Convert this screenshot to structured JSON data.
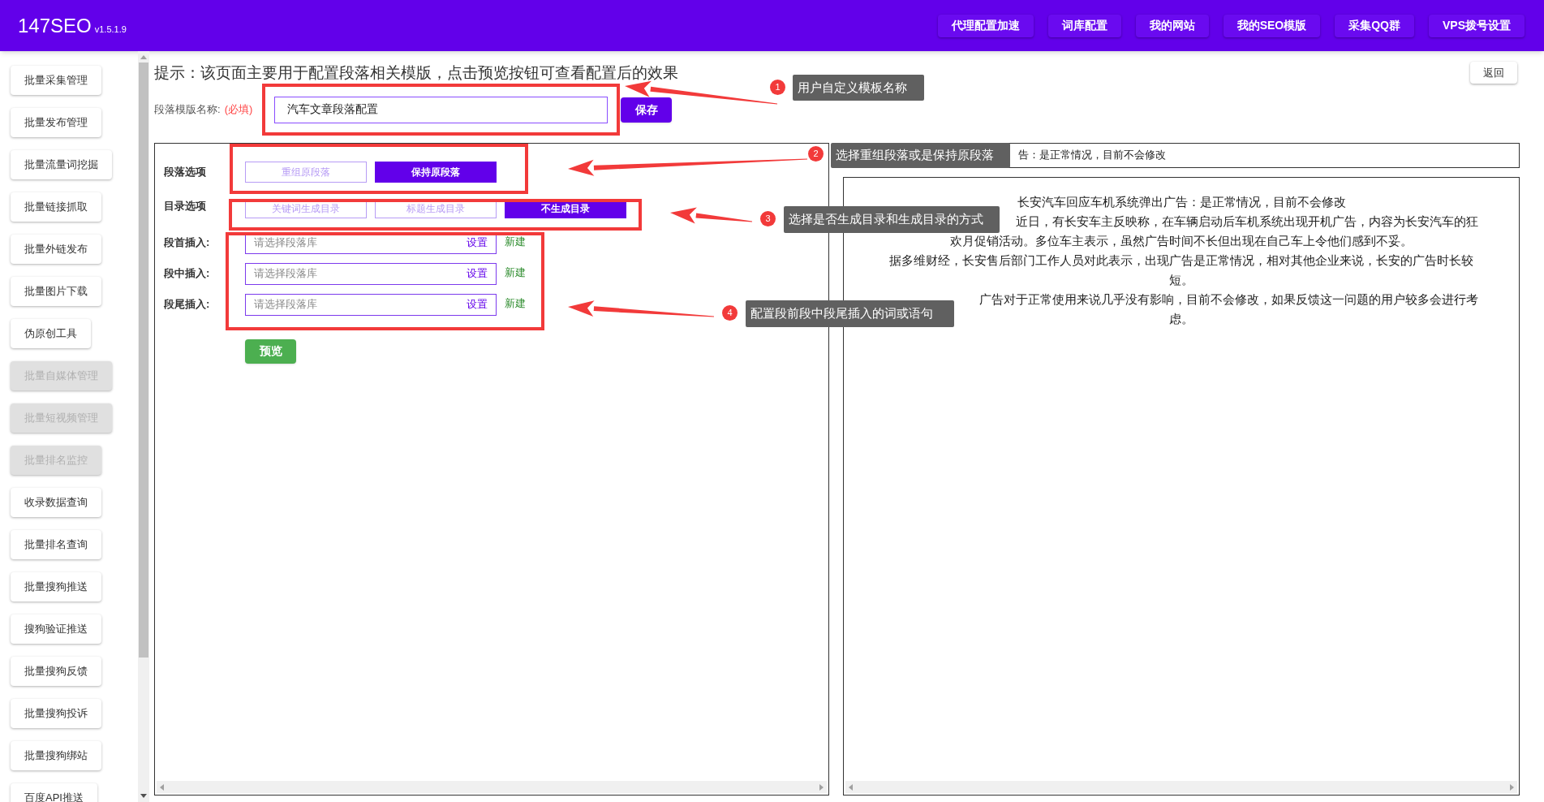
{
  "header": {
    "title": "147SEO",
    "version": "v1.5.1.9",
    "nav": [
      {
        "label": "代理配置加速"
      },
      {
        "label": "词库配置"
      },
      {
        "label": "我的网站"
      },
      {
        "label": "我的SEO模版"
      },
      {
        "label": "采集QQ群"
      },
      {
        "label": "VPS拨号设置"
      }
    ]
  },
  "sidebar": {
    "items": [
      {
        "label": "批量采集管理",
        "disabled": false
      },
      {
        "label": "批量发布管理",
        "disabled": false
      },
      {
        "label": "批量流量词挖掘",
        "disabled": false
      },
      {
        "label": "批量链接抓取",
        "disabled": false
      },
      {
        "label": "批量外链发布",
        "disabled": false
      },
      {
        "label": "批量图片下载",
        "disabled": false
      },
      {
        "label": "伪原创工具",
        "disabled": false
      },
      {
        "label": "批量自媒体管理",
        "disabled": true
      },
      {
        "label": "批量短视频管理",
        "disabled": true
      },
      {
        "label": "批量排名监控",
        "disabled": true
      },
      {
        "label": "收录数据查询",
        "disabled": false
      },
      {
        "label": "批量排名查询",
        "disabled": false
      },
      {
        "label": "批量搜狗推送",
        "disabled": false
      },
      {
        "label": "搜狗验证推送",
        "disabled": false
      },
      {
        "label": "批量搜狗反馈",
        "disabled": false
      },
      {
        "label": "批量搜狗投诉",
        "disabled": false
      },
      {
        "label": "批量搜狗绑站",
        "disabled": false
      },
      {
        "label": "百度API推送",
        "disabled": false
      }
    ]
  },
  "hint": "提示：该页面主要用于配置段落相关模版，点击预览按钮可查看配置后的效果",
  "back_button": "返回",
  "name_field": {
    "label": "段落模版名称:",
    "required": "(必填)",
    "value": "汽车文章段落配置"
  },
  "save_button": "保存",
  "paragraph_option": {
    "label": "段落选项",
    "choices": [
      {
        "label": "重组原段落",
        "selected": false
      },
      {
        "label": "保持原段落",
        "selected": true
      }
    ]
  },
  "toc_option": {
    "label": "目录选项",
    "choices": [
      {
        "label": "关键词生成目录",
        "selected": false
      },
      {
        "label": "标题生成目录",
        "selected": false
      },
      {
        "label": "不生成目录",
        "selected": true
      }
    ]
  },
  "inserts": [
    {
      "label": "段首插入:",
      "placeholder": "请选择段落库",
      "set": "设置",
      "new": "新建"
    },
    {
      "label": "段中插入:",
      "placeholder": "请选择段落库",
      "set": "设置",
      "new": "新建"
    },
    {
      "label": "段尾插入:",
      "placeholder": "请选择段落库",
      "set": "设置",
      "new": "新建"
    }
  ],
  "preview_button": "预览",
  "preview": {
    "title": "告：是正常情况，目前不会修改",
    "lines": [
      {
        "kind": "full",
        "text": "长安汽车回应车机系统弹出广告：是正常情况，目前不会修改"
      },
      {
        "kind": "partial",
        "text": "近日，有长安车主反映称，在车辆启动后车机系统出现开机广告，内容为长安汽车的狂"
      },
      {
        "kind": "full",
        "text": "欢月促销活动。多位车主表示，虽然广告时间不长但出现在自己车上令他们感到不妥。"
      },
      {
        "kind": "full",
        "text": "据多维财经，长安售后部门工作人员对此表示，出现广告是正常情况，相对其他企业来说，长安的广告时长较"
      },
      {
        "kind": "full",
        "text": "短。"
      },
      {
        "kind": "partial",
        "text": "广告对于正常使用来说几乎没有影响，目前不会修改，如果反馈这一问题的用户较多会进行考"
      },
      {
        "kind": "full",
        "text": "虑。"
      }
    ]
  },
  "annotations": [
    {
      "number": "1",
      "text": "用户自定义模板名称"
    },
    {
      "number": "2",
      "text": "选择重组段落或是保持原段落"
    },
    {
      "number": "3",
      "text": "选择是否生成目录和生成目录的方式"
    },
    {
      "number": "4",
      "text": "配置段前段中段尾插入的词或语句"
    }
  ]
}
